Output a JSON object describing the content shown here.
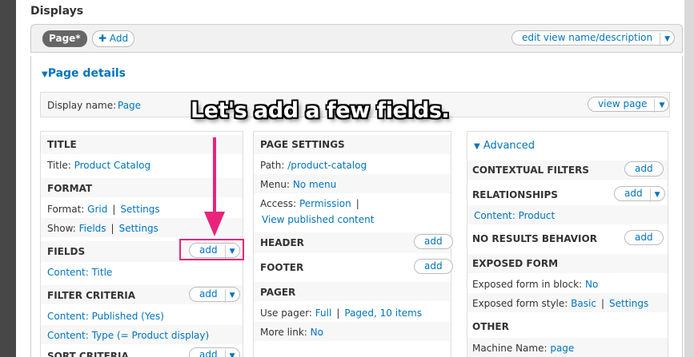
{
  "page": {
    "title": "Displays"
  },
  "topbar": {
    "tab_page": "Page*",
    "add_label": "Add",
    "edit_name_label": "edit view name/description"
  },
  "section": {
    "page_details": "Page details"
  },
  "display_name": {
    "label": "Display name:",
    "value": "Page",
    "view_page": "view page"
  },
  "callout": "Let's add a few fields.",
  "col1": {
    "title_head": "TITLE",
    "title_label": "Title:",
    "title_value": "Product Catalog",
    "format_head": "FORMAT",
    "format_label": "Format:",
    "format_value": "Grid",
    "format_settings": "Settings",
    "show_label": "Show:",
    "show_value": "Fields",
    "show_settings": "Settings",
    "fields_head": "FIELDS",
    "fields_add": "add",
    "fields_item": "Content: Title",
    "filter_head": "FILTER CRITERIA",
    "filter_add": "add",
    "filter_item1": "Content: Published (Yes)",
    "filter_item2": "Content: Type (= Product display)",
    "sort_head": "SORT CRITERIA",
    "sort_add": "add"
  },
  "col2": {
    "settings_head": "PAGE SETTINGS",
    "path_label": "Path:",
    "path_value": "/product-catalog",
    "menu_label": "Menu:",
    "menu_value": "No menu",
    "access_label": "Access:",
    "access_value": "Permission",
    "access_value2": "View published content",
    "header_head": "HEADER",
    "header_add": "add",
    "footer_head": "FOOTER",
    "footer_add": "add",
    "pager_head": "PAGER",
    "pager_label": "Use pager:",
    "pager_value": "Full",
    "pager_value2": "Paged, 10 items",
    "more_label": "More link:",
    "more_value": "No"
  },
  "col3": {
    "advanced": "Advanced",
    "contextual_head": "CONTEXTUAL FILTERS",
    "contextual_add": "add",
    "relationships_head": "RELATIONSHIPS",
    "relationships_add": "add",
    "relationships_item": "Content: Product",
    "noresults_head": "NO RESULTS BEHAVIOR",
    "noresults_add": "add",
    "exposed_head": "EXPOSED FORM",
    "exposed_block_label": "Exposed form in block:",
    "exposed_block_value": "No",
    "exposed_style_label": "Exposed form style:",
    "exposed_style_value": "Basic",
    "exposed_style_settings": "Settings",
    "other_head": "OTHER",
    "machine_label": "Machine Name:",
    "machine_value": "page"
  },
  "colors": {
    "link": "#0074bd",
    "highlight": "#e8247d"
  }
}
